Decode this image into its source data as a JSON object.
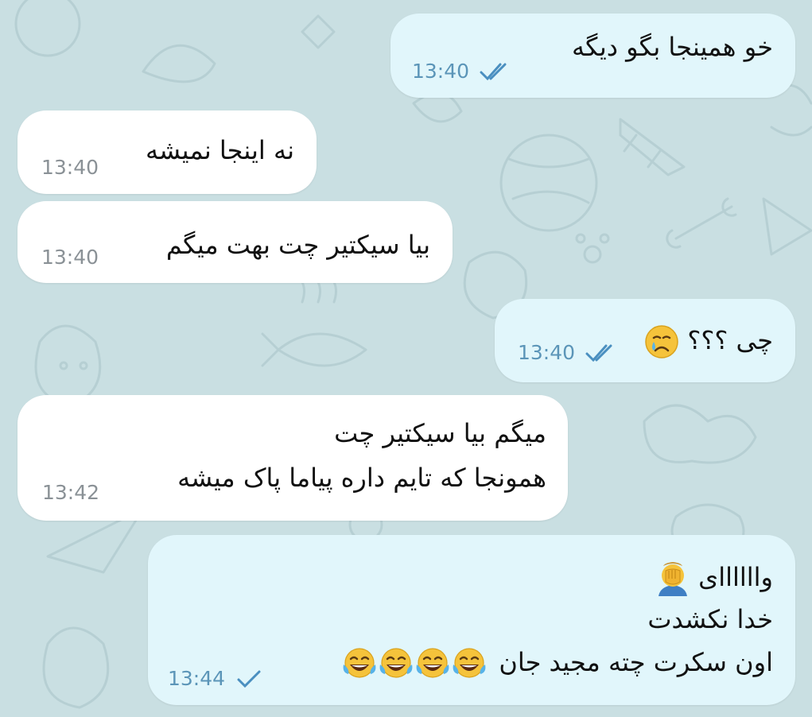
{
  "chat": {
    "messages": [
      {
        "direction": "out",
        "lines": [
          "خو همینجا بگو دیگه"
        ],
        "time": "13:40",
        "status": "read"
      },
      {
        "direction": "in",
        "lines": [
          "نه اینجا نمیشه"
        ],
        "time": "13:40"
      },
      {
        "direction": "in",
        "lines": [
          "بیا سیکتیر چت بهت میگم"
        ],
        "time": "13:40"
      },
      {
        "direction": "out",
        "lines": [
          "چی ؟؟؟"
        ],
        "time": "13:40",
        "status": "read",
        "emoji": "crying-face"
      },
      {
        "direction": "in",
        "lines": [
          "میگم بیا سیکتیر چت",
          "همونجا که تایم داره پیاما پاک میشه"
        ],
        "time": "13:42"
      },
      {
        "direction": "out",
        "lines": [
          "واااااای",
          "خدا نکشدت",
          "اون سکرت چته مجید جان"
        ],
        "time": "13:44",
        "status": "sent",
        "emoji": [
          "facepalm",
          "joy",
          "joy",
          "joy",
          "joy"
        ]
      }
    ]
  },
  "colors": {
    "outgoing": "#e1f6fb",
    "incoming": "#ffffff",
    "wallpaper": "#c9dfe2",
    "tick": "#4a8fc0"
  }
}
